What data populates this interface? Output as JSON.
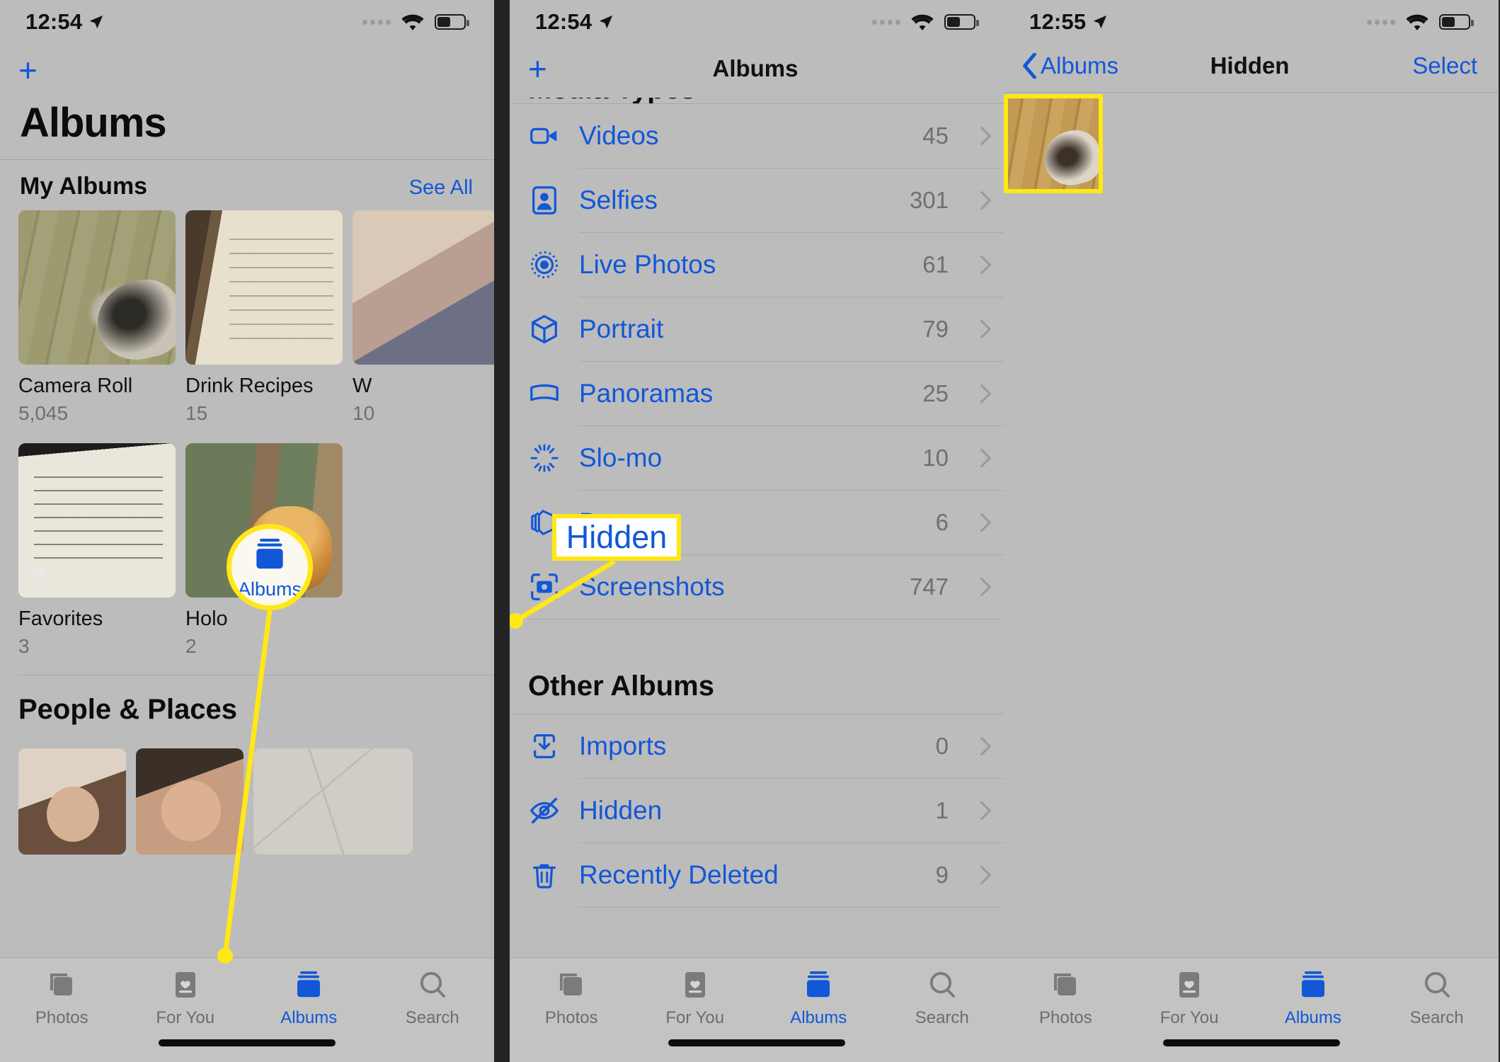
{
  "panel1": {
    "status": {
      "time": "12:54",
      "location_icon": "location-arrow-icon",
      "wifi_icon": "wifi-icon",
      "battery_icon": "battery-icon"
    },
    "nav": {
      "add_button": "+",
      "title": "Albums"
    },
    "my_albums": {
      "section_title": "My Albums",
      "see_all": "See All",
      "items": [
        {
          "name": "Camera Roll",
          "count": "5,045"
        },
        {
          "name": "Drink Recipes",
          "count": "15"
        },
        {
          "name": "W",
          "count": "10"
        },
        {
          "name": "Favorites",
          "count": "3"
        },
        {
          "name": "Holo",
          "count": "2"
        }
      ]
    },
    "people_places": {
      "section_title": "People & Places"
    },
    "tabs": [
      {
        "label": "Photos",
        "icon": "photos-icon",
        "active": false
      },
      {
        "label": "For You",
        "icon": "for-you-icon",
        "active": false
      },
      {
        "label": "Albums",
        "icon": "albums-icon",
        "active": true
      },
      {
        "label": "Search",
        "icon": "search-icon",
        "active": false
      }
    ],
    "annotation": {
      "label": "Albums"
    }
  },
  "panel2": {
    "status": {
      "time": "12:54"
    },
    "nav": {
      "add_button": "+",
      "title": "Albums"
    },
    "media_types": {
      "section_title": "Media Types",
      "items": [
        {
          "label": "Videos",
          "count": "45",
          "icon": "video-camera-icon"
        },
        {
          "label": "Selfies",
          "count": "301",
          "icon": "person-portrait-icon"
        },
        {
          "label": "Live Photos",
          "count": "61",
          "icon": "live-photo-icon"
        },
        {
          "label": "Portrait",
          "count": "79",
          "icon": "cube-icon"
        },
        {
          "label": "Panoramas",
          "count": "25",
          "icon": "panorama-icon"
        },
        {
          "label": "Slo-mo",
          "count": "10",
          "icon": "slo-mo-icon"
        },
        {
          "label": "Bursts",
          "count": "6",
          "icon": "bursts-icon"
        },
        {
          "label": "Screenshots",
          "count": "747",
          "icon": "screenshot-icon"
        }
      ]
    },
    "other_albums": {
      "section_title": "Other Albums",
      "items": [
        {
          "label": "Imports",
          "count": "0",
          "icon": "import-icon"
        },
        {
          "label": "Hidden",
          "count": "1",
          "icon": "eye-slash-icon"
        },
        {
          "label": "Recently Deleted",
          "count": "9",
          "icon": "trash-icon"
        }
      ]
    },
    "tabs": [
      {
        "label": "Photos",
        "icon": "photos-icon",
        "active": false
      },
      {
        "label": "For You",
        "icon": "for-you-icon",
        "active": false
      },
      {
        "label": "Albums",
        "icon": "albums-icon",
        "active": true
      },
      {
        "label": "Search",
        "icon": "search-icon",
        "active": false
      }
    ],
    "annotation": {
      "label": "Hidden"
    }
  },
  "panel3": {
    "status": {
      "time": "12:55"
    },
    "nav": {
      "back_label": "Albums",
      "title": "Hidden",
      "select_label": "Select"
    },
    "tabs": [
      {
        "label": "Photos",
        "icon": "photos-icon",
        "active": false
      },
      {
        "label": "For You",
        "icon": "for-you-icon",
        "active": false
      },
      {
        "label": "Albums",
        "icon": "albums-icon",
        "active": true
      },
      {
        "label": "Search",
        "icon": "search-icon",
        "active": false
      }
    ]
  },
  "colors": {
    "accent_blue": "#1257d8",
    "highlight_yellow": "#ffe815",
    "panel_bg": "#bcbcbc",
    "muted_text": "#6f6f6f"
  }
}
